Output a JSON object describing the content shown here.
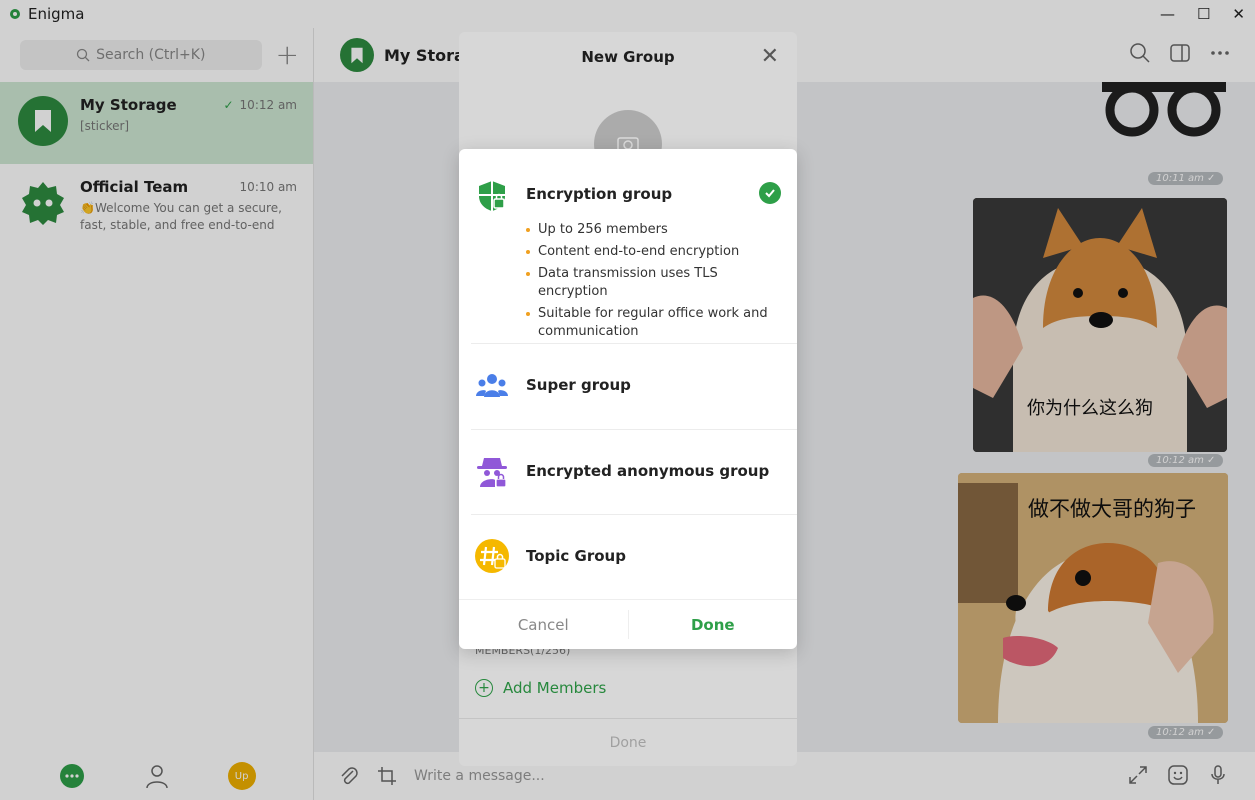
{
  "app": {
    "title": "Enigma",
    "controls": [
      "—",
      "☐",
      "✕"
    ]
  },
  "sidebar": {
    "search_placeholder": "Search (Ctrl+K)",
    "chats": [
      {
        "name": "My Storage",
        "preview": "[sticker]",
        "time": "10:12 am",
        "status": "✓"
      },
      {
        "name": "Official Team",
        "preview": "👏Welcome You can get a secure, fast, stable, and free end-to-end",
        "time": "10:10 am"
      }
    ],
    "bottom": {
      "profile_badge": "Up"
    }
  },
  "main": {
    "header_title": "My Storage",
    "timestamps": [
      "10:11 am ✓",
      "10:12 am ✓",
      "10:12 am ✓"
    ],
    "stickers": [
      {
        "caption": "你为什么这么狗"
      },
      {
        "caption": "做不做大哥的狗子"
      }
    ],
    "composer_placeholder": "Write a message..."
  },
  "new_group": {
    "title": "New Group",
    "members_label": "MEMBERS(1/256)",
    "add_members": "Add Members",
    "done": "Done"
  },
  "group_type_dialog": {
    "options": [
      {
        "name": "Encryption group",
        "icon": "shield-lock-icon",
        "selected": true,
        "features": [
          "Up to 256 members",
          "Content end-to-end encryption",
          "Data transmission uses TLS encryption",
          "Suitable for regular office work and communication"
        ]
      },
      {
        "name": "Super group",
        "icon": "people-icon"
      },
      {
        "name": "Encrypted anonymous group",
        "icon": "spy-icon"
      },
      {
        "name": "Topic Group",
        "icon": "hashtag-icon"
      }
    ],
    "cancel": "Cancel",
    "done": "Done"
  },
  "colors": {
    "accent": "#2e9f48",
    "bullet": "#f0a020",
    "super_group": "#4a7ee8",
    "anonymous": "#9058d8",
    "topic": "#f5b800"
  }
}
